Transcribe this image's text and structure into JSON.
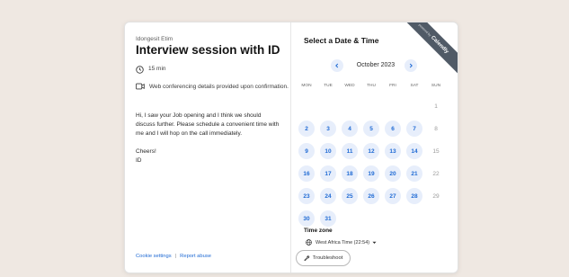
{
  "event": {
    "host": "Idongesit Etim",
    "title": "Interview session with ID",
    "duration": "15 min",
    "location": "Web conferencing details provided upon confirmation.",
    "message": "Hi, I saw your Job opening and I think we should discuss further. Please schedule a convenient time with me and I will hop on the call immediately.\n\nCheers!\nID"
  },
  "footer": {
    "cookie": "Cookie settings",
    "separator": "|",
    "report": "Report abuse"
  },
  "scheduler": {
    "heading": "Select a Date & Time",
    "ribbon": {
      "small": "powered by",
      "brand": "Calendly"
    },
    "month": "October 2023",
    "weekdays": [
      "MON",
      "TUE",
      "WED",
      "THU",
      "FRI",
      "SAT",
      "SUN"
    ],
    "days": [
      {
        "d": "1",
        "col": 6,
        "row": 0,
        "avail": false
      },
      {
        "d": "2",
        "col": 0,
        "row": 1,
        "avail": true
      },
      {
        "d": "3",
        "col": 1,
        "row": 1,
        "avail": true
      },
      {
        "d": "4",
        "col": 2,
        "row": 1,
        "avail": true
      },
      {
        "d": "5",
        "col": 3,
        "row": 1,
        "avail": true
      },
      {
        "d": "6",
        "col": 4,
        "row": 1,
        "avail": true
      },
      {
        "d": "7",
        "col": 5,
        "row": 1,
        "avail": true
      },
      {
        "d": "8",
        "col": 6,
        "row": 1,
        "avail": false
      },
      {
        "d": "9",
        "col": 0,
        "row": 2,
        "avail": true
      },
      {
        "d": "10",
        "col": 1,
        "row": 2,
        "avail": true
      },
      {
        "d": "11",
        "col": 2,
        "row": 2,
        "avail": true
      },
      {
        "d": "12",
        "col": 3,
        "row": 2,
        "avail": true
      },
      {
        "d": "13",
        "col": 4,
        "row": 2,
        "avail": true
      },
      {
        "d": "14",
        "col": 5,
        "row": 2,
        "avail": true
      },
      {
        "d": "15",
        "col": 6,
        "row": 2,
        "avail": false
      },
      {
        "d": "16",
        "col": 0,
        "row": 3,
        "avail": true
      },
      {
        "d": "17",
        "col": 1,
        "row": 3,
        "avail": true
      },
      {
        "d": "18",
        "col": 2,
        "row": 3,
        "avail": true
      },
      {
        "d": "19",
        "col": 3,
        "row": 3,
        "avail": true
      },
      {
        "d": "20",
        "col": 4,
        "row": 3,
        "avail": true
      },
      {
        "d": "21",
        "col": 5,
        "row": 3,
        "avail": true
      },
      {
        "d": "22",
        "col": 6,
        "row": 3,
        "avail": false
      },
      {
        "d": "23",
        "col": 0,
        "row": 4,
        "avail": true
      },
      {
        "d": "24",
        "col": 1,
        "row": 4,
        "avail": true
      },
      {
        "d": "25",
        "col": 2,
        "row": 4,
        "avail": true
      },
      {
        "d": "26",
        "col": 3,
        "row": 4,
        "avail": true
      },
      {
        "d": "27",
        "col": 4,
        "row": 4,
        "avail": true
      },
      {
        "d": "28",
        "col": 5,
        "row": 4,
        "avail": true
      },
      {
        "d": "29",
        "col": 6,
        "row": 4,
        "avail": false
      },
      {
        "d": "30",
        "col": 0,
        "row": 5,
        "avail": true
      },
      {
        "d": "31",
        "col": 1,
        "row": 5,
        "avail": true
      }
    ],
    "timezone_label": "Time zone",
    "timezone_value": "West Africa Time (22:54)",
    "troubleshoot": "Troubleshoot"
  },
  "icons": {
    "clock": "clock-icon",
    "video": "video-camera-icon",
    "globe": "globe-icon",
    "chevron_left": "chevron-left-icon",
    "chevron_right": "chevron-right-icon",
    "wrench": "wrench-icon"
  },
  "colors": {
    "accent": "#1f6ad4",
    "available_bg": "#e7eefb",
    "ribbon": "#505a66",
    "page_bg": "#efe8e2"
  }
}
